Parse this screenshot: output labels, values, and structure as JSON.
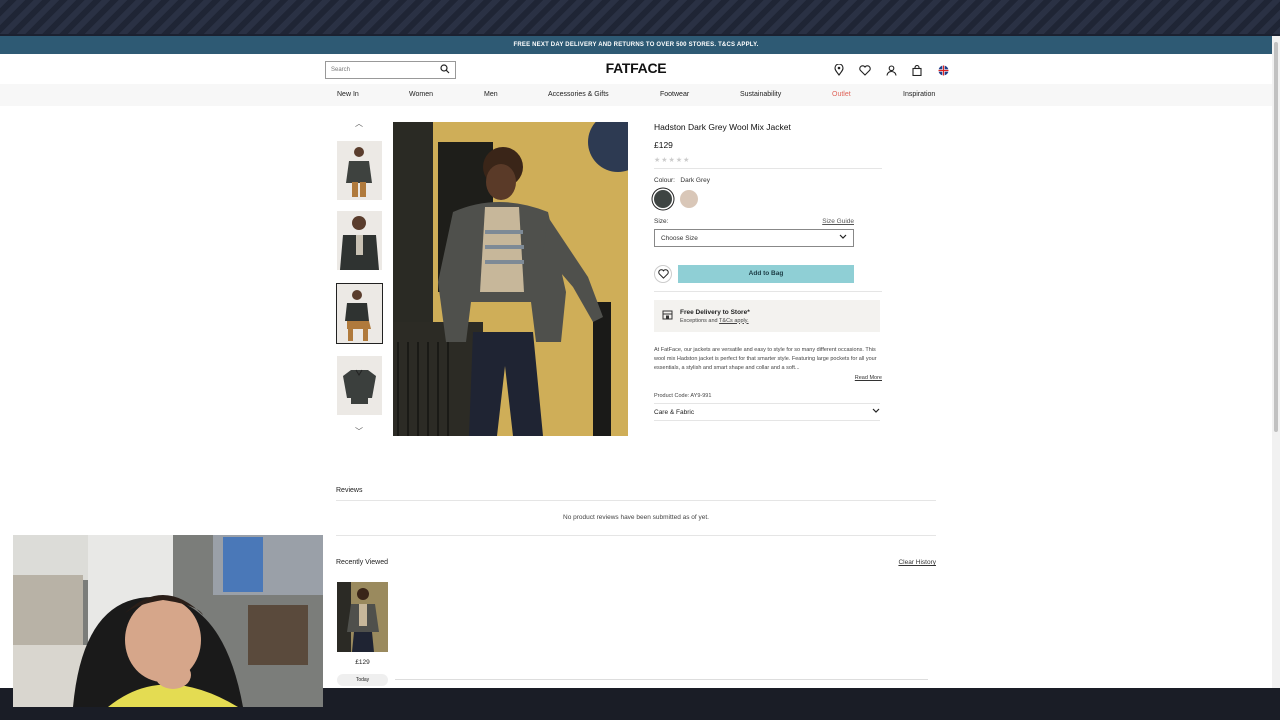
{
  "promo": {
    "text": "FREE NEXT DAY DELIVERY AND RETURNS TO OVER 500 STORES. T&CS APPLY."
  },
  "header": {
    "search_placeholder": "Search",
    "logo": "FATFACE",
    "icons": [
      "location-pin-icon",
      "heart-icon",
      "account-icon",
      "bag-icon",
      "uk-flag-icon"
    ]
  },
  "nav": {
    "items": [
      "New In",
      "Women",
      "Men",
      "Accessories & Gifts",
      "Footwear",
      "Sustainability",
      "Outlet",
      "Inspiration"
    ],
    "outlet_color": "#e0645a"
  },
  "product": {
    "title": "Hadston Dark Grey Wool Mix Jacket",
    "price": "£129",
    "rating": 0,
    "colour_label": "Colour:",
    "colour_value": "Dark Grey",
    "swatches": [
      "#3f4543",
      "#d9c7b8"
    ],
    "size_label": "Size:",
    "size_guide": "Size Guide",
    "size_select": "Choose Size",
    "add_to_bag": "Add to Bag",
    "delivery_title": "Free Delivery to Store*",
    "delivery_sub_a": "Exceptions and",
    "delivery_sub_link": "T&Cs apply.",
    "description": "At FatFace, our jackets are versatile and easy to style for so many different occasions. This wool mix Hadston jacket is perfect for that smarter style. Featuring large pockets for all your essentials, a stylish and smart shape and collar and a soft...",
    "read_more": "Read More",
    "product_code": "Product Code: AY9-991",
    "care": "Care & Fabric"
  },
  "reviews": {
    "title": "Reviews",
    "empty": "No product reviews have been submitted as of yet."
  },
  "recently_viewed": {
    "title": "Recently Viewed",
    "clear": "Clear History",
    "price": "£129",
    "today": "Today"
  }
}
